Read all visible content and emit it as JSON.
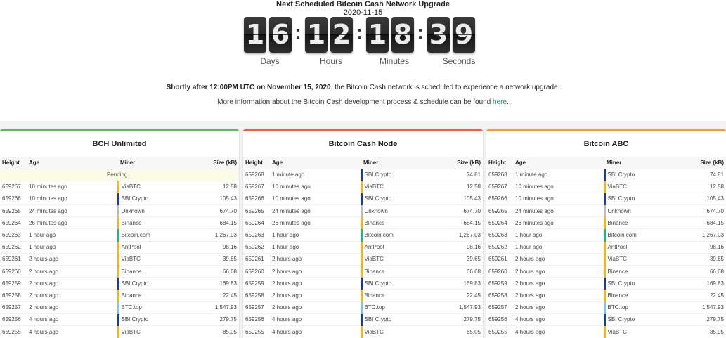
{
  "header": {
    "title": "Next Scheduled Bitcoin Cash Network Upgrade",
    "date": "2020-11-15"
  },
  "countdown": {
    "days": [
      "1",
      "6"
    ],
    "hours": [
      "1",
      "2"
    ],
    "minutes": [
      "1",
      "8"
    ],
    "seconds": [
      "3",
      "9"
    ],
    "labels": [
      "Days",
      "Hours",
      "Minutes",
      "Seconds"
    ]
  },
  "notice": {
    "bold": "Shortly after 12:00PM UTC on November 15, 2020",
    "rest": ", the Bitcoin Cash network is scheduled to experience a network upgrade.",
    "info": "More information about the Bitcoin Cash development process & schedule can be found ",
    "link": "here",
    "period": "."
  },
  "columns": [
    "Height",
    "Age",
    "Miner",
    "Size (kB)"
  ],
  "miner_colors": {
    "ViaBTC": "#f0b429",
    "SBI Crypto": "#1e3a8a",
    "Unknown": "#bbbbbb",
    "Binance": "#f0b429",
    "Bitcoin.com": "#2ab27b",
    "AntPool": "#f0b429",
    "BTC.top": "#7ec8e3"
  },
  "panels": [
    {
      "name": "BCH Unlimited",
      "color": "#5cb85c",
      "pending": "Pending...",
      "rows": [
        [
          "659267",
          "10 minutes ago",
          "ViaBTC",
          "12.58"
        ],
        [
          "659266",
          "10 minutes ago",
          "SBI Crypto",
          "105.43"
        ],
        [
          "659265",
          "24 minutes ago",
          "Unknown",
          "674.70"
        ],
        [
          "659264",
          "26 minutes ago",
          "Binance",
          "684.15"
        ],
        [
          "659263",
          "1 hour ago",
          "Bitcoin.com",
          "1,267.03"
        ],
        [
          "659262",
          "1 hour ago",
          "AntPool",
          "98.16"
        ],
        [
          "659261",
          "2 hours ago",
          "ViaBTC",
          "39.65"
        ],
        [
          "659260",
          "2 hours ago",
          "Binance",
          "66.68"
        ],
        [
          "659259",
          "2 hours ago",
          "SBI Crypto",
          "169.83"
        ],
        [
          "659258",
          "2 hours ago",
          "Binance",
          "22.45"
        ],
        [
          "659257",
          "2 hours ago",
          "BTC.top",
          "1,547.93"
        ],
        [
          "659256",
          "4 hours ago",
          "SBI Crypto",
          "279.75"
        ],
        [
          "659255",
          "4 hours ago",
          "ViaBTC",
          "85.05"
        ]
      ]
    },
    {
      "name": "Bitcoin Cash Node",
      "color": "#e8643c",
      "pending": "",
      "rows": [
        [
          "659268",
          "1 minute ago",
          "SBI Crypto",
          "74.81"
        ],
        [
          "659267",
          "10 minutes ago",
          "ViaBTC",
          "12.58"
        ],
        [
          "659266",
          "10 minutes ago",
          "SBI Crypto",
          "105.43"
        ],
        [
          "659265",
          "24 minutes ago",
          "Unknown",
          "674.70"
        ],
        [
          "659264",
          "26 minutes ago",
          "Binance",
          "684.15"
        ],
        [
          "659263",
          "1 hour ago",
          "Bitcoin.com",
          "1,267.03"
        ],
        [
          "659262",
          "1 hour ago",
          "AntPool",
          "98.16"
        ],
        [
          "659261",
          "2 hours ago",
          "ViaBTC",
          "39.65"
        ],
        [
          "659260",
          "2 hours ago",
          "Binance",
          "66.68"
        ],
        [
          "659259",
          "2 hours ago",
          "SBI Crypto",
          "169.83"
        ],
        [
          "659258",
          "2 hours ago",
          "Binance",
          "22.45"
        ],
        [
          "659257",
          "2 hours ago",
          "BTC.top",
          "1,547.93"
        ],
        [
          "659256",
          "4 hours ago",
          "SBI Crypto",
          "279.75"
        ],
        [
          "659255",
          "4 hours ago",
          "ViaBTC",
          "85.05"
        ]
      ]
    },
    {
      "name": "Bitcoin ABC",
      "color": "#f0a030",
      "pending": "",
      "rows": [
        [
          "659268",
          "1 minute ago",
          "SBI Crypto",
          "74.81"
        ],
        [
          "659267",
          "10 minutes ago",
          "ViaBTC",
          "12.58"
        ],
        [
          "659266",
          "10 minutes ago",
          "SBI Crypto",
          "105.43"
        ],
        [
          "659265",
          "24 minutes ago",
          "Unknown",
          "674.70"
        ],
        [
          "659264",
          "26 minutes ago",
          "Binance",
          "684.15"
        ],
        [
          "659263",
          "1 hour ago",
          "Bitcoin.com",
          "1,267.03"
        ],
        [
          "659262",
          "1 hour ago",
          "AntPool",
          "98.16"
        ],
        [
          "659261",
          "2 hours ago",
          "ViaBTC",
          "39.65"
        ],
        [
          "659260",
          "2 hours ago",
          "Binance",
          "66.68"
        ],
        [
          "659259",
          "2 hours ago",
          "SBI Crypto",
          "169.83"
        ],
        [
          "659258",
          "2 hours ago",
          "Binance",
          "22.45"
        ],
        [
          "659257",
          "2 hours ago",
          "BTC.top",
          "1,547.93"
        ],
        [
          "659256",
          "4 hours ago",
          "SBI Crypto",
          "279.75"
        ],
        [
          "659255",
          "4 hours ago",
          "ViaBTC",
          "85.05"
        ]
      ]
    }
  ]
}
